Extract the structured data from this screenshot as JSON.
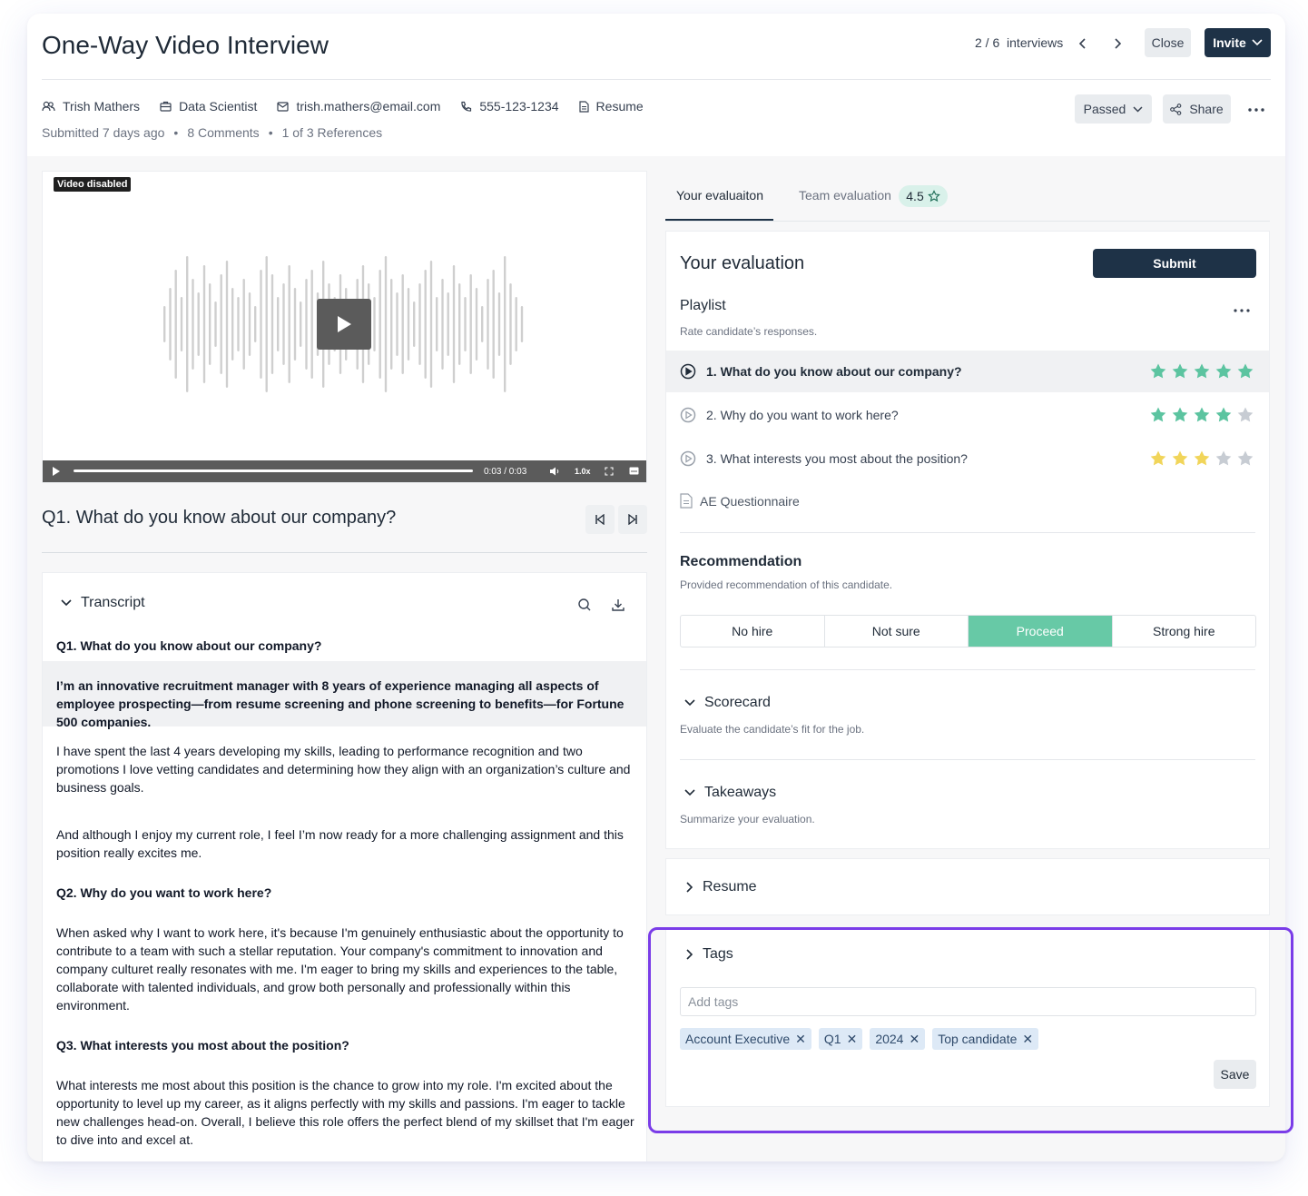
{
  "header": {
    "title": "One-Way Video Interview",
    "nav_counter": "2 / 6",
    "nav_unit": "interviews",
    "close_label": "Close",
    "invite_label": "Invite"
  },
  "candidate": {
    "name": "Trish Mathers",
    "role": "Data Scientist",
    "email": "trish.mathers@email.com",
    "phone": "555-123-1234",
    "resume_label": "Resume",
    "submitted": "Submitted 7 days ago",
    "comments": "8 Comments",
    "references": "1 of 3 References",
    "status_label": "Passed",
    "share_label": "Share"
  },
  "video": {
    "badge": "Video disabled",
    "time": "0:03 / 0:03",
    "speed": "1.0x",
    "progress": 1.0
  },
  "question": {
    "title": "Q1. What do you know about our company?"
  },
  "transcript": {
    "heading": "Transcript",
    "q1": "Q1. What do you know about our company?",
    "q1_p1": "I’m an innovative recruitment manager with 8 years of experience managing all aspects of employee prospecting—from resume screening and phone screening to benefits—for Fortune 500 companies.",
    "q1_p2": "I have spent the last 4 years developing my skills, leading to performance recognition and two promotions I love vetting candidates and determining how they align with an organization’s culture and business goals.",
    "q1_p3": "And although I enjoy my current role, I feel I’m now ready for a more challenging assignment and this position really excites me.",
    "q2": "Q2. Why do you want to work here?",
    "q2_p1": "When asked why I want to work here, it's because I'm genuinely enthusiastic about the opportunity to contribute to a team with such a stellar reputation. Your company's commitment to innovation and company culturet really resonates with me. I'm eager to bring my skills and experiences to the table, collaborate with talented individuals, and grow both personally and professionally within this environment.",
    "q3": "Q3. What interests you most about the position?",
    "q3_p1": "What interests me most about this position is the chance to grow into my role. I'm excited about the opportunity to level up my career, as it aligns perfectly with my skills and passions. I'm eager to tackle new challenges head-on. Overall, I believe this role offers the perfect blend of my skillset that I'm eager to dive into and excel at."
  },
  "tabs": {
    "your": "Your evaluaiton",
    "team": "Team evaluation",
    "team_score": "4.5"
  },
  "evaluation": {
    "title": "Your evaluation",
    "submit_label": "Submit",
    "playlist_title": "Playlist",
    "playlist_sub": "Rate candidate’s responses.",
    "playlist": [
      {
        "label": "1. What do you know about our company?",
        "rating": 5,
        "color": "#5cc4a0"
      },
      {
        "label": "2. Why do you want to work here?",
        "rating": 4,
        "color": "#5cc4a0"
      },
      {
        "label": "3. What interests you most about the position?",
        "rating": 3,
        "color": "#f1d55a"
      }
    ],
    "questionnaire": "AE Questionnaire",
    "recommendation_title": "Recommendation",
    "recommendation_sub": "Provided recommendation of this candidate.",
    "recommendation_options": [
      "No hire",
      "Not sure",
      "Proceed",
      "Strong hire"
    ],
    "recommendation_selected": "Proceed",
    "scorecard_title": "Scorecard",
    "scorecard_sub": "Evaluate the candidate’s fit for the job.",
    "takeaways_title": "Takeaways",
    "takeaways_sub": "Summarize your evaluation."
  },
  "resume_section": {
    "title": "Resume"
  },
  "tags": {
    "title": "Tags",
    "placeholder": "Add tags",
    "items": [
      "Account Executive",
      "Q1",
      "2024",
      "Top candidate"
    ],
    "save_label": "Save"
  },
  "colors": {
    "primary": "#1e3247",
    "accent_green": "#67c9a6",
    "star_yellow": "#f1d55a",
    "star_empty": "#c7ccd3",
    "highlight": "#7a3ce8"
  }
}
